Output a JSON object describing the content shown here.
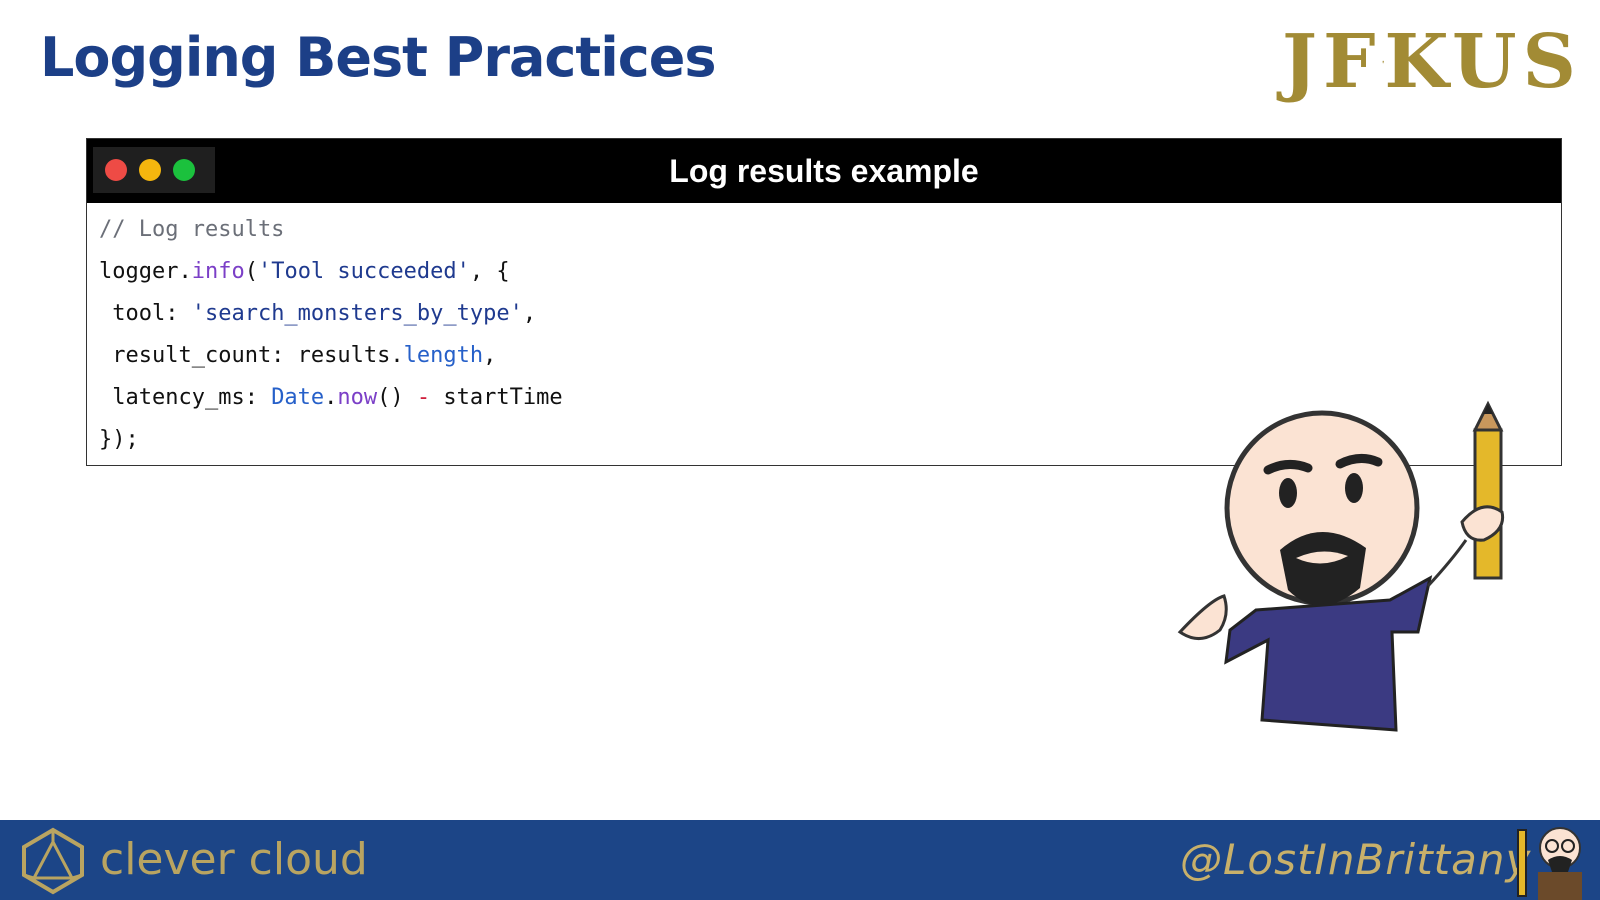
{
  "slide": {
    "title": "Logging Best Practices",
    "logo_text_left": "JF",
    "logo_text_right": "KUS"
  },
  "window": {
    "title": "Log results example",
    "code_lines": [
      "// Log results",
      "logger.info('Tool succeeded', {",
      " tool: 'search_monsters_by_type',",
      " result_count: results.length,",
      " latency_ms: Date.now() - startTime",
      "});"
    ],
    "tokens": {
      "l1": [
        "logger.",
        "info",
        "(",
        "'Tool succeeded'",
        ", {"
      ],
      "l2": [
        " tool: ",
        "'search_monsters_by_type'",
        ","
      ],
      "l3": [
        " result_count: results.",
        "length",
        ","
      ],
      "l4": [
        " latency_ms: ",
        "Date",
        ".",
        "now",
        "() ",
        "-",
        " startTime"
      ]
    }
  },
  "footer": {
    "brand": "clever cloud",
    "handle": "@LostInBrittany"
  },
  "colors": {
    "title_blue": "#1c3f87",
    "footer_blue": "#1c4587",
    "gold": "#a28b35",
    "dot_red": "#ee4b45",
    "dot_yellow": "#f5b60e",
    "dot_green": "#1bc13d"
  },
  "icons": [
    "jfokus-logo",
    "clever-cloud-logo",
    "avatar-illustration",
    "footer-avatar-icon"
  ]
}
